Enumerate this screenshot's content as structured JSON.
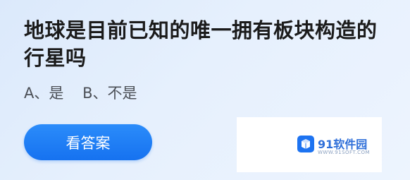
{
  "question": {
    "text": "地球是目前已知的唯一拥有板块构造的行星吗"
  },
  "options": {
    "text": "A、是    B、不是"
  },
  "answer_button": {
    "label": "看答案"
  },
  "watermark": {
    "name": "91软件园",
    "url": "WWW.91SOFT.COM",
    "logo_icon": "box-icon",
    "accent": "#1d73f1"
  },
  "colors": {
    "button": "#1672f0",
    "background": "#e3eefc"
  }
}
